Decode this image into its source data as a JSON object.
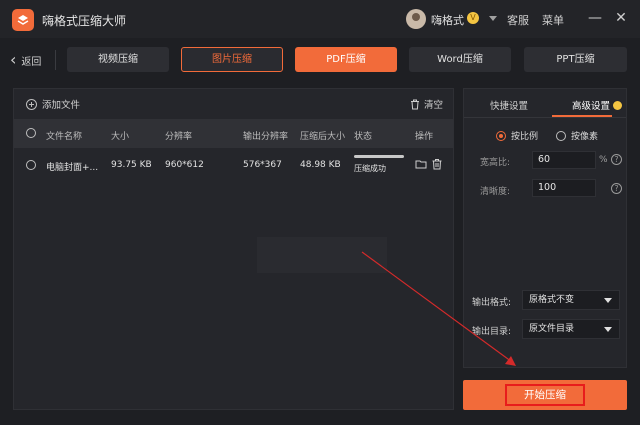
{
  "app": {
    "title": "嗨格式压缩大师",
    "username": "嗨格式",
    "vip_badge": "V",
    "service_label": "客服",
    "menu_label": "菜单"
  },
  "nav": {
    "back_label": "返回",
    "tabs": [
      {
        "label": "视频压缩",
        "state": "normal"
      },
      {
        "label": "图片压缩",
        "state": "outlined"
      },
      {
        "label": "PDF压缩",
        "state": "active"
      },
      {
        "label": "Word压缩",
        "state": "normal"
      },
      {
        "label": "PPT压缩",
        "state": "normal"
      }
    ]
  },
  "file_list": {
    "add_file_label": "添加文件",
    "clear_label": "清空",
    "columns": [
      "文件名称",
      "大小",
      "分辨率",
      "输出分辨率",
      "压缩后大小",
      "状态",
      "操作"
    ],
    "rows": [
      {
        "name": "电脑封面+...",
        "size": "93.75 KB",
        "resolution": "960*612",
        "output_resolution": "576*367",
        "compressed_size": "48.98 KB",
        "status": "压缩成功",
        "progress": 1.0
      }
    ]
  },
  "settings": {
    "tabs": [
      "快捷设置",
      "高级设置"
    ],
    "active_tab": "高级设置",
    "mode_options": [
      "按比例",
      "按像素"
    ],
    "selected_mode": "按比例",
    "ratio_label": "宽高比:",
    "ratio_value": "60",
    "ratio_unit": "%",
    "clarity_label": "清晰度:",
    "clarity_value": "100",
    "help_glyph": "?",
    "output_format_label": "输出格式:",
    "output_format_value": "原格式不变",
    "output_dir_label": "输出目录:",
    "output_dir_value": "原文件目录"
  },
  "actions": {
    "start_label": "开始压缩"
  },
  "colors": {
    "accent": "#f26b3a",
    "highlight_box": "#e81c1c",
    "arrow": "#d42a2a"
  }
}
